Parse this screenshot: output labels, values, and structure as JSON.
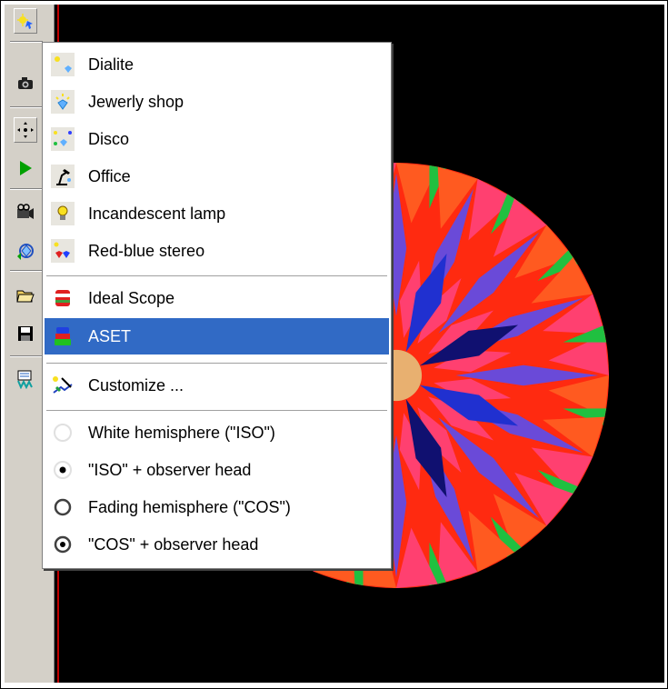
{
  "toolbar": {
    "buttons": [
      {
        "icon": "lighting-icon",
        "pressed": true
      },
      {
        "icon": "camera-icon",
        "pressed": false
      },
      {
        "icon": "move-icon",
        "pressed": true
      },
      {
        "icon": "play-icon",
        "pressed": false
      },
      {
        "icon": "camera-settings-icon",
        "pressed": false
      },
      {
        "icon": "rotate-gem-icon",
        "pressed": false
      },
      {
        "icon": "open-folder-icon",
        "pressed": false
      },
      {
        "icon": "save-disk-icon",
        "pressed": false
      },
      {
        "icon": "report-icon",
        "pressed": false
      }
    ]
  },
  "menu": {
    "items": [
      {
        "label": "Dialite",
        "icon": "dialite-icon",
        "selected": false
      },
      {
        "label": "Jewerly shop",
        "icon": "jewelry-shop-icon",
        "selected": false
      },
      {
        "label": "Disco",
        "icon": "disco-icon",
        "selected": false
      },
      {
        "label": "Office",
        "icon": "office-lamp-icon",
        "selected": false
      },
      {
        "label": "Incandescent lamp",
        "icon": "light-bulb-icon",
        "selected": false
      },
      {
        "label": "Red-blue stereo",
        "icon": "stereo-icon",
        "selected": false
      },
      {
        "label": "Ideal Scope",
        "icon": "ideal-scope-icon",
        "selected": false
      },
      {
        "label": "ASET",
        "icon": "aset-icon",
        "selected": true
      },
      {
        "label": "Customize ...",
        "icon": "customize-icon",
        "selected": false
      },
      {
        "label": "White hemisphere (\"ISO\")",
        "icon": "white-hemisphere-icon",
        "selected": false
      },
      {
        "label": "\"ISO\" + observer head",
        "icon": "radio-dot-icon",
        "selected": false
      },
      {
        "label": "Fading hemisphere (\"COS\")",
        "icon": "radio-circle-icon",
        "selected": false
      },
      {
        "label": "\"COS\" + observer head",
        "icon": "radio-dot-circle-icon",
        "selected": false
      }
    ]
  },
  "colors": {
    "selection": "#316ac5",
    "toolbar_face": "#d4d0c8",
    "viewport_bg": "#000000",
    "gem_red": "#ff2a10",
    "gem_orange": "#ff5a20",
    "gem_pink": "#ff4070",
    "gem_green": "#20c040",
    "gem_blue": "#2030d0",
    "gem_navy": "#101070",
    "gem_violet": "#6a4ad8",
    "gem_culet": "#e8b070"
  }
}
